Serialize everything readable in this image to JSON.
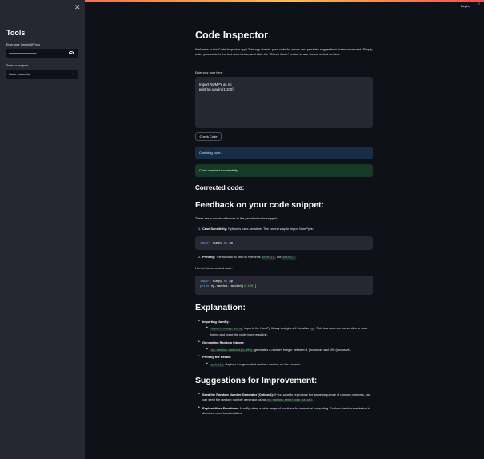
{
  "sidebar": {
    "close_icon": "close-icon",
    "title": "Tools",
    "api_key_label": "Enter your Gemini API key",
    "api_key_value": "••••••••••••••••••••••••••••••••••••••",
    "program_label": "Select a program",
    "program_value": "Code Inspector"
  },
  "header": {
    "deploy_label": "Deploy",
    "menu_icon": "vertical-ellipsis-icon"
  },
  "main": {
    "title": "Code Inspector",
    "intro": "Welcome to the Code Inspector app! This app checks your code for errors and provides suggestions for improvement. Simply enter your code in the text area below, and click the \"Check Code\" button to see the corrected version.",
    "code_label": "Enter your code here:",
    "code_lines": [
      "Import NUMPY as np",
      "print(np.randint(1,100))"
    ],
    "check_button": "Check Code",
    "info_text": "Checking code...",
    "success_text": "Code checked successfully!",
    "corrected_heading": "Corrected code:",
    "feedback_heading": "Feedback on your code snippet:",
    "feedback_intro": "There are a couple of issues in the provided code snippet:",
    "issue1_num": "1.",
    "issue1_bold": "Case Sensitivity:",
    "issue1_text": " Python is case-sensitive. The correct way to import NumPy is:",
    "block1": {
      "kw1": "import",
      "mod": " numpy ",
      "kw2": "as",
      "alias": " np"
    },
    "issue2_num": "2.",
    "issue2_bold": "Printing:",
    "issue2_text1": " The function to print in Python is ",
    "issue2_code1": "print()",
    "issue2_text2": ", not ",
    "issue2_code2": "print()",
    "issue2_text3": ".",
    "corrected_intro": "Here's the corrected code:",
    "block2": {
      "l1_kw1": "import",
      "l1_mod": " numpy ",
      "l1_kw2": "as",
      "l1_alias": " np",
      "l2_fn": "print",
      "l2_rest": "(np.random.randint(",
      "l2_args": "1,100",
      "l2_end": "))"
    },
    "explanation_heading": "Explanation:",
    "exp1_bold": "Importing NumPy:",
    "exp1_code": "import numpy as np",
    "exp1_text1": " imports the NumPy library and gives it the alias ",
    "exp1_code2": "np",
    "exp1_text2": ". This is a common convention to save typing and make the code more readable.",
    "exp2_bold": "Generating Random Integer:",
    "exp2_code": "np.random.randint(1,100)",
    "exp2_text": " generates a random integer between 1 (inclusive) and 100 (exclusive).",
    "exp3_bold": "Printing the Result:",
    "exp3_code": "print()",
    "exp3_text": " displays the generated random number on the console.",
    "suggestions_heading": "Suggestions for Improvement:",
    "sug1_bold": "Seed the Random Number Generator (Optional):",
    "sug1_text1": " If you want to reproduce the same sequence of random numbers, you can seed the random number generator using ",
    "sug1_code": "np.random.seed(some_value)",
    "sug1_text2": ".",
    "sug2_bold": "Explore More Functions:",
    "sug2_text": " NumPy offers a wide range of functions for numerical computing. Explore the documentation to discover more functionalities."
  }
}
